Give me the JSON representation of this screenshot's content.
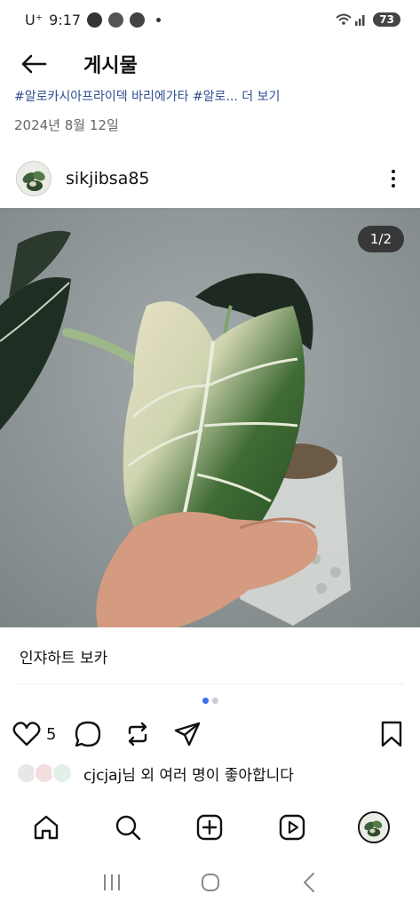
{
  "status_bar": {
    "carrier": "U⁺",
    "time": "9:17",
    "battery": "73"
  },
  "header": {
    "title": "게시물"
  },
  "post": {
    "hashtags": "#알로카시아프라이덱 바리에가타 #알로... 더 보기",
    "date": "2024년 8월 12일",
    "username": "sikjibsa85",
    "page_counter": "1/2",
    "caption": "인쟈하트 보카",
    "likes": "5",
    "likers_user": "cjcjaj",
    "likers_text": "님 외 여러 명이 좋아합니다"
  },
  "icons": {
    "back": "back-arrow-icon",
    "more": "more-vertical-icon",
    "like": "heart-icon",
    "comment": "comment-icon",
    "repost": "repost-icon",
    "share": "send-icon",
    "save": "bookmark-icon",
    "nav": [
      "home-icon",
      "search-icon",
      "create-icon",
      "reels-icon",
      "profile-avatar"
    ],
    "system": [
      "recent-apps-icon",
      "home-circle-icon",
      "system-back-icon"
    ]
  },
  "colors": {
    "accent": "#3a6ef5",
    "text": "#111111",
    "muted": "#666666"
  }
}
